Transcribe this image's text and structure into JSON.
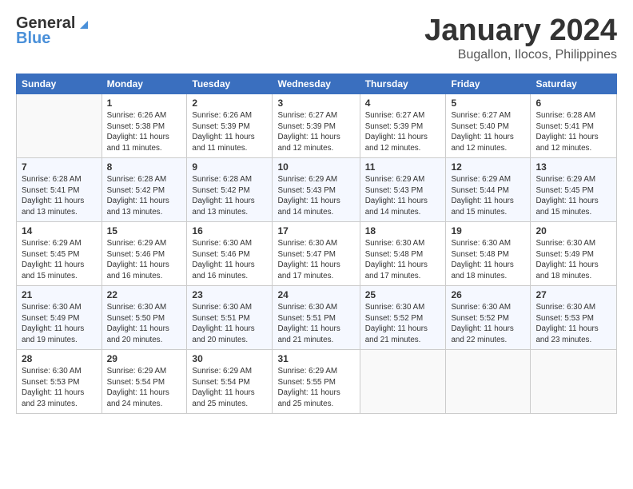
{
  "header": {
    "logo_general": "General",
    "logo_blue": "Blue",
    "month": "January 2024",
    "location": "Bugallon, Ilocos, Philippines"
  },
  "weekdays": [
    "Sunday",
    "Monday",
    "Tuesday",
    "Wednesday",
    "Thursday",
    "Friday",
    "Saturday"
  ],
  "weeks": [
    [
      {
        "day": "",
        "sunrise": "",
        "sunset": "",
        "daylight": ""
      },
      {
        "day": "1",
        "sunrise": "Sunrise: 6:26 AM",
        "sunset": "Sunset: 5:38 PM",
        "daylight": "Daylight: 11 hours and 11 minutes."
      },
      {
        "day": "2",
        "sunrise": "Sunrise: 6:26 AM",
        "sunset": "Sunset: 5:39 PM",
        "daylight": "Daylight: 11 hours and 11 minutes."
      },
      {
        "day": "3",
        "sunrise": "Sunrise: 6:27 AM",
        "sunset": "Sunset: 5:39 PM",
        "daylight": "Daylight: 11 hours and 12 minutes."
      },
      {
        "day": "4",
        "sunrise": "Sunrise: 6:27 AM",
        "sunset": "Sunset: 5:39 PM",
        "daylight": "Daylight: 11 hours and 12 minutes."
      },
      {
        "day": "5",
        "sunrise": "Sunrise: 6:27 AM",
        "sunset": "Sunset: 5:40 PM",
        "daylight": "Daylight: 11 hours and 12 minutes."
      },
      {
        "day": "6",
        "sunrise": "Sunrise: 6:28 AM",
        "sunset": "Sunset: 5:41 PM",
        "daylight": "Daylight: 11 hours and 12 minutes."
      }
    ],
    [
      {
        "day": "7",
        "sunrise": "Sunrise: 6:28 AM",
        "sunset": "Sunset: 5:41 PM",
        "daylight": "Daylight: 11 hours and 13 minutes."
      },
      {
        "day": "8",
        "sunrise": "Sunrise: 6:28 AM",
        "sunset": "Sunset: 5:42 PM",
        "daylight": "Daylight: 11 hours and 13 minutes."
      },
      {
        "day": "9",
        "sunrise": "Sunrise: 6:28 AM",
        "sunset": "Sunset: 5:42 PM",
        "daylight": "Daylight: 11 hours and 13 minutes."
      },
      {
        "day": "10",
        "sunrise": "Sunrise: 6:29 AM",
        "sunset": "Sunset: 5:43 PM",
        "daylight": "Daylight: 11 hours and 14 minutes."
      },
      {
        "day": "11",
        "sunrise": "Sunrise: 6:29 AM",
        "sunset": "Sunset: 5:43 PM",
        "daylight": "Daylight: 11 hours and 14 minutes."
      },
      {
        "day": "12",
        "sunrise": "Sunrise: 6:29 AM",
        "sunset": "Sunset: 5:44 PM",
        "daylight": "Daylight: 11 hours and 15 minutes."
      },
      {
        "day": "13",
        "sunrise": "Sunrise: 6:29 AM",
        "sunset": "Sunset: 5:45 PM",
        "daylight": "Daylight: 11 hours and 15 minutes."
      }
    ],
    [
      {
        "day": "14",
        "sunrise": "Sunrise: 6:29 AM",
        "sunset": "Sunset: 5:45 PM",
        "daylight": "Daylight: 11 hours and 15 minutes."
      },
      {
        "day": "15",
        "sunrise": "Sunrise: 6:29 AM",
        "sunset": "Sunset: 5:46 PM",
        "daylight": "Daylight: 11 hours and 16 minutes."
      },
      {
        "day": "16",
        "sunrise": "Sunrise: 6:30 AM",
        "sunset": "Sunset: 5:46 PM",
        "daylight": "Daylight: 11 hours and 16 minutes."
      },
      {
        "day": "17",
        "sunrise": "Sunrise: 6:30 AM",
        "sunset": "Sunset: 5:47 PM",
        "daylight": "Daylight: 11 hours and 17 minutes."
      },
      {
        "day": "18",
        "sunrise": "Sunrise: 6:30 AM",
        "sunset": "Sunset: 5:48 PM",
        "daylight": "Daylight: 11 hours and 17 minutes."
      },
      {
        "day": "19",
        "sunrise": "Sunrise: 6:30 AM",
        "sunset": "Sunset: 5:48 PM",
        "daylight": "Daylight: 11 hours and 18 minutes."
      },
      {
        "day": "20",
        "sunrise": "Sunrise: 6:30 AM",
        "sunset": "Sunset: 5:49 PM",
        "daylight": "Daylight: 11 hours and 18 minutes."
      }
    ],
    [
      {
        "day": "21",
        "sunrise": "Sunrise: 6:30 AM",
        "sunset": "Sunset: 5:49 PM",
        "daylight": "Daylight: 11 hours and 19 minutes."
      },
      {
        "day": "22",
        "sunrise": "Sunrise: 6:30 AM",
        "sunset": "Sunset: 5:50 PM",
        "daylight": "Daylight: 11 hours and 20 minutes."
      },
      {
        "day": "23",
        "sunrise": "Sunrise: 6:30 AM",
        "sunset": "Sunset: 5:51 PM",
        "daylight": "Daylight: 11 hours and 20 minutes."
      },
      {
        "day": "24",
        "sunrise": "Sunrise: 6:30 AM",
        "sunset": "Sunset: 5:51 PM",
        "daylight": "Daylight: 11 hours and 21 minutes."
      },
      {
        "day": "25",
        "sunrise": "Sunrise: 6:30 AM",
        "sunset": "Sunset: 5:52 PM",
        "daylight": "Daylight: 11 hours and 21 minutes."
      },
      {
        "day": "26",
        "sunrise": "Sunrise: 6:30 AM",
        "sunset": "Sunset: 5:52 PM",
        "daylight": "Daylight: 11 hours and 22 minutes."
      },
      {
        "day": "27",
        "sunrise": "Sunrise: 6:30 AM",
        "sunset": "Sunset: 5:53 PM",
        "daylight": "Daylight: 11 hours and 23 minutes."
      }
    ],
    [
      {
        "day": "28",
        "sunrise": "Sunrise: 6:30 AM",
        "sunset": "Sunset: 5:53 PM",
        "daylight": "Daylight: 11 hours and 23 minutes."
      },
      {
        "day": "29",
        "sunrise": "Sunrise: 6:29 AM",
        "sunset": "Sunset: 5:54 PM",
        "daylight": "Daylight: 11 hours and 24 minutes."
      },
      {
        "day": "30",
        "sunrise": "Sunrise: 6:29 AM",
        "sunset": "Sunset: 5:54 PM",
        "daylight": "Daylight: 11 hours and 25 minutes."
      },
      {
        "day": "31",
        "sunrise": "Sunrise: 6:29 AM",
        "sunset": "Sunset: 5:55 PM",
        "daylight": "Daylight: 11 hours and 25 minutes."
      },
      {
        "day": "",
        "sunrise": "",
        "sunset": "",
        "daylight": ""
      },
      {
        "day": "",
        "sunrise": "",
        "sunset": "",
        "daylight": ""
      },
      {
        "day": "",
        "sunrise": "",
        "sunset": "",
        "daylight": ""
      }
    ]
  ]
}
